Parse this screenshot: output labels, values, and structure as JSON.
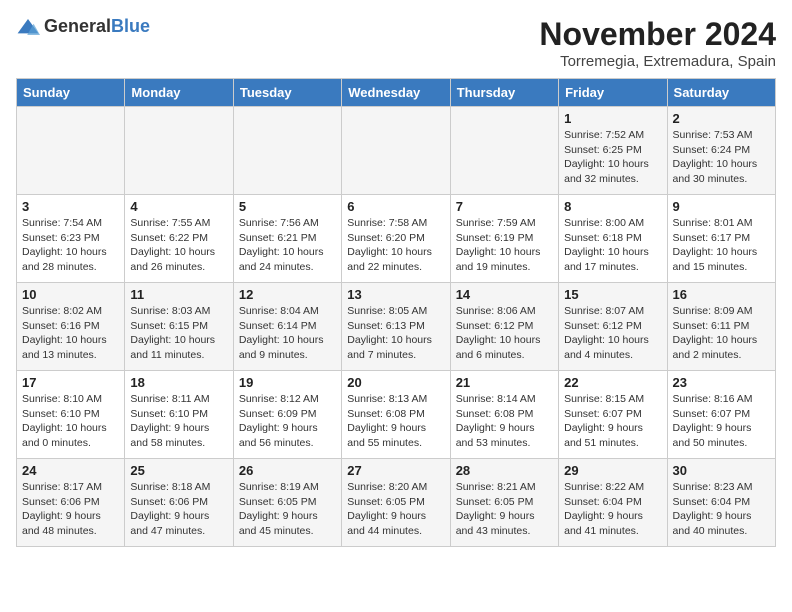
{
  "header": {
    "logo": {
      "general": "General",
      "blue": "Blue"
    },
    "title": "November 2024",
    "location": "Torremegia, Extremadura, Spain"
  },
  "weekdays": [
    "Sunday",
    "Monday",
    "Tuesday",
    "Wednesday",
    "Thursday",
    "Friday",
    "Saturday"
  ],
  "weeks": [
    {
      "days": [
        {
          "num": "",
          "info": ""
        },
        {
          "num": "",
          "info": ""
        },
        {
          "num": "",
          "info": ""
        },
        {
          "num": "",
          "info": ""
        },
        {
          "num": "",
          "info": ""
        },
        {
          "num": "1",
          "info": "Sunrise: 7:52 AM\nSunset: 6:25 PM\nDaylight: 10 hours and 32 minutes."
        },
        {
          "num": "2",
          "info": "Sunrise: 7:53 AM\nSunset: 6:24 PM\nDaylight: 10 hours and 30 minutes."
        }
      ]
    },
    {
      "days": [
        {
          "num": "3",
          "info": "Sunrise: 7:54 AM\nSunset: 6:23 PM\nDaylight: 10 hours and 28 minutes."
        },
        {
          "num": "4",
          "info": "Sunrise: 7:55 AM\nSunset: 6:22 PM\nDaylight: 10 hours and 26 minutes."
        },
        {
          "num": "5",
          "info": "Sunrise: 7:56 AM\nSunset: 6:21 PM\nDaylight: 10 hours and 24 minutes."
        },
        {
          "num": "6",
          "info": "Sunrise: 7:58 AM\nSunset: 6:20 PM\nDaylight: 10 hours and 22 minutes."
        },
        {
          "num": "7",
          "info": "Sunrise: 7:59 AM\nSunset: 6:19 PM\nDaylight: 10 hours and 19 minutes."
        },
        {
          "num": "8",
          "info": "Sunrise: 8:00 AM\nSunset: 6:18 PM\nDaylight: 10 hours and 17 minutes."
        },
        {
          "num": "9",
          "info": "Sunrise: 8:01 AM\nSunset: 6:17 PM\nDaylight: 10 hours and 15 minutes."
        }
      ]
    },
    {
      "days": [
        {
          "num": "10",
          "info": "Sunrise: 8:02 AM\nSunset: 6:16 PM\nDaylight: 10 hours and 13 minutes."
        },
        {
          "num": "11",
          "info": "Sunrise: 8:03 AM\nSunset: 6:15 PM\nDaylight: 10 hours and 11 minutes."
        },
        {
          "num": "12",
          "info": "Sunrise: 8:04 AM\nSunset: 6:14 PM\nDaylight: 10 hours and 9 minutes."
        },
        {
          "num": "13",
          "info": "Sunrise: 8:05 AM\nSunset: 6:13 PM\nDaylight: 10 hours and 7 minutes."
        },
        {
          "num": "14",
          "info": "Sunrise: 8:06 AM\nSunset: 6:12 PM\nDaylight: 10 hours and 6 minutes."
        },
        {
          "num": "15",
          "info": "Sunrise: 8:07 AM\nSunset: 6:12 PM\nDaylight: 10 hours and 4 minutes."
        },
        {
          "num": "16",
          "info": "Sunrise: 8:09 AM\nSunset: 6:11 PM\nDaylight: 10 hours and 2 minutes."
        }
      ]
    },
    {
      "days": [
        {
          "num": "17",
          "info": "Sunrise: 8:10 AM\nSunset: 6:10 PM\nDaylight: 10 hours and 0 minutes."
        },
        {
          "num": "18",
          "info": "Sunrise: 8:11 AM\nSunset: 6:10 PM\nDaylight: 9 hours and 58 minutes."
        },
        {
          "num": "19",
          "info": "Sunrise: 8:12 AM\nSunset: 6:09 PM\nDaylight: 9 hours and 56 minutes."
        },
        {
          "num": "20",
          "info": "Sunrise: 8:13 AM\nSunset: 6:08 PM\nDaylight: 9 hours and 55 minutes."
        },
        {
          "num": "21",
          "info": "Sunrise: 8:14 AM\nSunset: 6:08 PM\nDaylight: 9 hours and 53 minutes."
        },
        {
          "num": "22",
          "info": "Sunrise: 8:15 AM\nSunset: 6:07 PM\nDaylight: 9 hours and 51 minutes."
        },
        {
          "num": "23",
          "info": "Sunrise: 8:16 AM\nSunset: 6:07 PM\nDaylight: 9 hours and 50 minutes."
        }
      ]
    },
    {
      "days": [
        {
          "num": "24",
          "info": "Sunrise: 8:17 AM\nSunset: 6:06 PM\nDaylight: 9 hours and 48 minutes."
        },
        {
          "num": "25",
          "info": "Sunrise: 8:18 AM\nSunset: 6:06 PM\nDaylight: 9 hours and 47 minutes."
        },
        {
          "num": "26",
          "info": "Sunrise: 8:19 AM\nSunset: 6:05 PM\nDaylight: 9 hours and 45 minutes."
        },
        {
          "num": "27",
          "info": "Sunrise: 8:20 AM\nSunset: 6:05 PM\nDaylight: 9 hours and 44 minutes."
        },
        {
          "num": "28",
          "info": "Sunrise: 8:21 AM\nSunset: 6:05 PM\nDaylight: 9 hours and 43 minutes."
        },
        {
          "num": "29",
          "info": "Sunrise: 8:22 AM\nSunset: 6:04 PM\nDaylight: 9 hours and 41 minutes."
        },
        {
          "num": "30",
          "info": "Sunrise: 8:23 AM\nSunset: 6:04 PM\nDaylight: 9 hours and 40 minutes."
        }
      ]
    }
  ]
}
